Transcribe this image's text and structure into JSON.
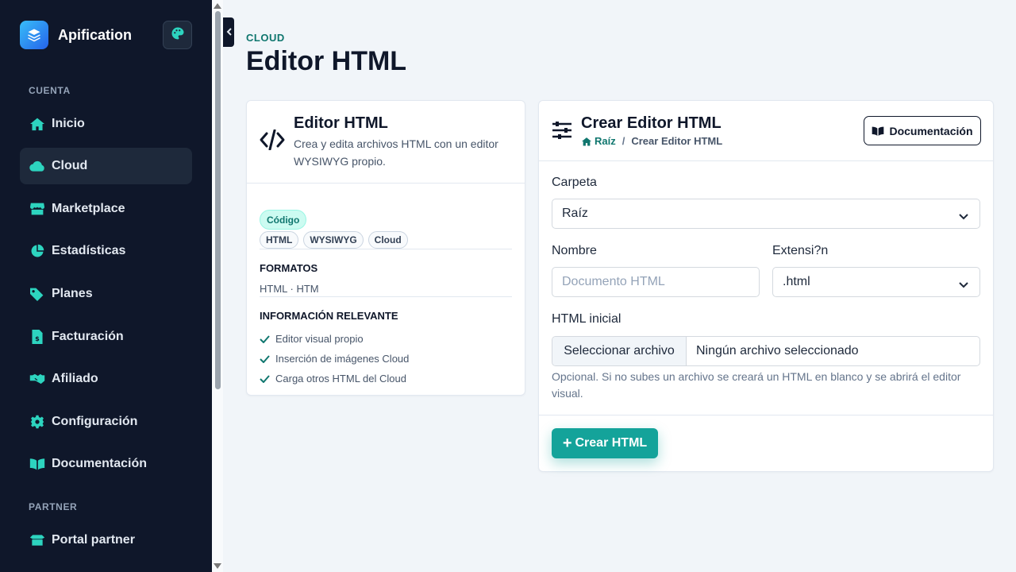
{
  "brand": {
    "name": "Apification"
  },
  "sidebar": {
    "sections": [
      {
        "label": "CUENTA"
      },
      {
        "label": "PARTNER"
      }
    ],
    "items": [
      {
        "label": "Inicio",
        "icon": "home-icon"
      },
      {
        "label": "Cloud",
        "icon": "cloud-icon",
        "active": true
      },
      {
        "label": "Marketplace",
        "icon": "store-icon"
      },
      {
        "label": "Estadísticas",
        "icon": "pie-chart-icon"
      },
      {
        "label": "Planes",
        "icon": "tags-icon"
      },
      {
        "label": "Facturación",
        "icon": "invoice-icon"
      },
      {
        "label": "Afiliado",
        "icon": "handshake-icon"
      },
      {
        "label": "Configuración",
        "icon": "gear-icon"
      },
      {
        "label": "Documentación",
        "icon": "book-open-icon"
      },
      {
        "label": "Portal partner",
        "icon": "box-open-icon"
      }
    ]
  },
  "header": {
    "eyebrow": "CLOUD",
    "title": "Editor HTML"
  },
  "info_card": {
    "title": "Editor HTML",
    "description": "Crea y edita archivos HTML con un editor WYSIWYG propio.",
    "badge": "Código",
    "tags": [
      "HTML",
      "WYSIWYG",
      "Cloud"
    ],
    "formats_heading": "FORMATOS",
    "formats": "HTML · HTM",
    "info_heading": "INFORMACIÓN RELEVANTE",
    "features": [
      "Editor visual propio",
      "Inserción de imágenes Cloud",
      "Carga otros HTML del Cloud"
    ]
  },
  "form_card": {
    "title": "Crear Editor HTML",
    "breadcrumb": {
      "home": "Raíz",
      "separator": "/",
      "current": "Crear Editor HTML"
    },
    "doc_button": "Documentación",
    "folder": {
      "label": "Carpeta",
      "value": "Raíz"
    },
    "name": {
      "label": "Nombre",
      "placeholder": "Documento HTML"
    },
    "extension": {
      "label": "Extensi?n",
      "value": ".html"
    },
    "initial_html": {
      "label": "HTML inicial",
      "button": "Seleccionar archivo",
      "status": "Ningún archivo seleccionado"
    },
    "help": "Opcional. Si no subes un archivo se creará un HTML en blanco y se abrirá el editor visual.",
    "submit": "Crear HTML"
  },
  "colors": {
    "sidebar_bg": "#0f172a",
    "accent": "#14a39a",
    "accent_dark": "#0f766e",
    "page_bg": "#f1f5f9"
  }
}
